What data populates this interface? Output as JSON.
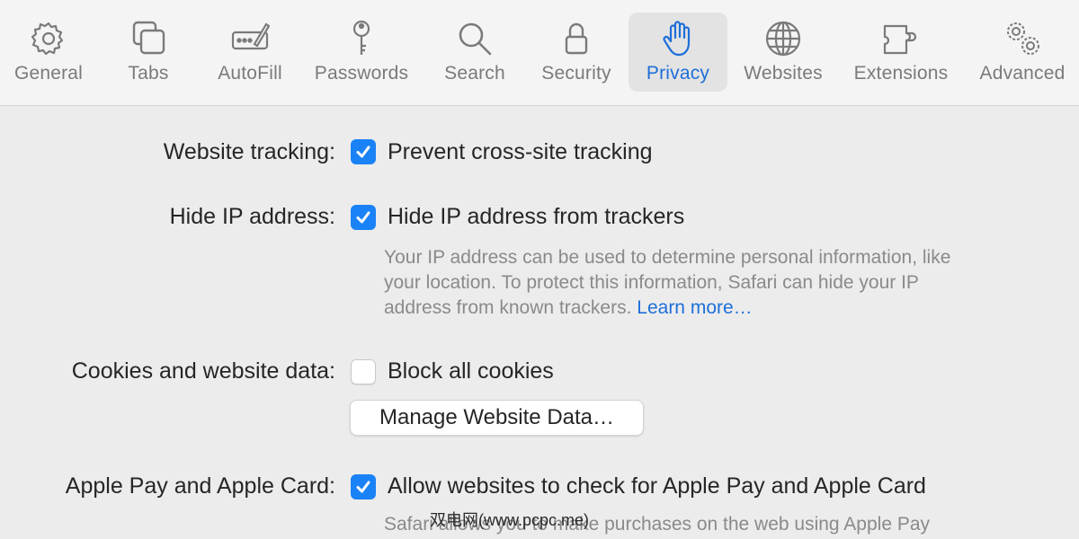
{
  "toolbar": {
    "tabs": [
      {
        "label": "General",
        "icon": "gear-icon"
      },
      {
        "label": "Tabs",
        "icon": "tabs-icon"
      },
      {
        "label": "AutoFill",
        "icon": "autofill-icon"
      },
      {
        "label": "Passwords",
        "icon": "key-icon"
      },
      {
        "label": "Search",
        "icon": "magnifier-icon"
      },
      {
        "label": "Security",
        "icon": "lock-icon"
      },
      {
        "label": "Privacy",
        "icon": "hand-icon"
      },
      {
        "label": "Websites",
        "icon": "globe-icon"
      },
      {
        "label": "Extensions",
        "icon": "puzzle-icon"
      },
      {
        "label": "Advanced",
        "icon": "gears-icon"
      }
    ],
    "active_tab": "Privacy"
  },
  "settings": {
    "tracking": {
      "label": "Website tracking:",
      "option": "Prevent cross-site tracking",
      "checked": true
    },
    "hide_ip": {
      "label": "Hide IP address:",
      "option": "Hide IP address from trackers",
      "checked": true,
      "desc_line1": "Your IP address can be used to determine personal information, like",
      "desc_line2": "your location. To protect this information, Safari can hide your IP",
      "desc_line3": "address from known trackers.",
      "link": "Learn more…"
    },
    "cookies": {
      "label": "Cookies and website data:",
      "option": "Block all cookies",
      "checked": false,
      "button": "Manage Website Data…"
    },
    "apple_pay": {
      "label": "Apple Pay and Apple Card:",
      "option": "Allow websites to check for Apple Pay and Apple Card",
      "checked": true,
      "desc_line1": "Safari allows you to make purchases on the web using Apple Pay"
    }
  },
  "watermark": "双电网(www.pcpc.me)",
  "colors": {
    "accent": "#1a82f7",
    "link": "#1e6fd9",
    "background": "#ececec",
    "toolbar": "#f4f4f4"
  }
}
